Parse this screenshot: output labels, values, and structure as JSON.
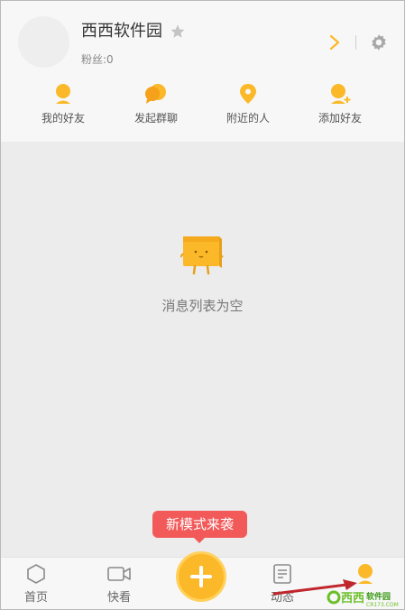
{
  "profile": {
    "name": "西西软件园",
    "fans": "粉丝:0"
  },
  "actions": [
    {
      "label": "我的好友"
    },
    {
      "label": "发起群聊"
    },
    {
      "label": "附近的人"
    },
    {
      "label": "添加好友"
    }
  ],
  "empty": {
    "message": "消息列表为空"
  },
  "tooltip": "新模式来袭",
  "nav": [
    {
      "label": "首页"
    },
    {
      "label": "快看"
    },
    {
      "label": "动态"
    }
  ],
  "watermark": {
    "text": "西西软件园",
    "domain": "CR173.COM"
  },
  "colors": {
    "accent": "#fbb828",
    "tooltip": "#f25a5a",
    "arrow": "#c0272d"
  }
}
